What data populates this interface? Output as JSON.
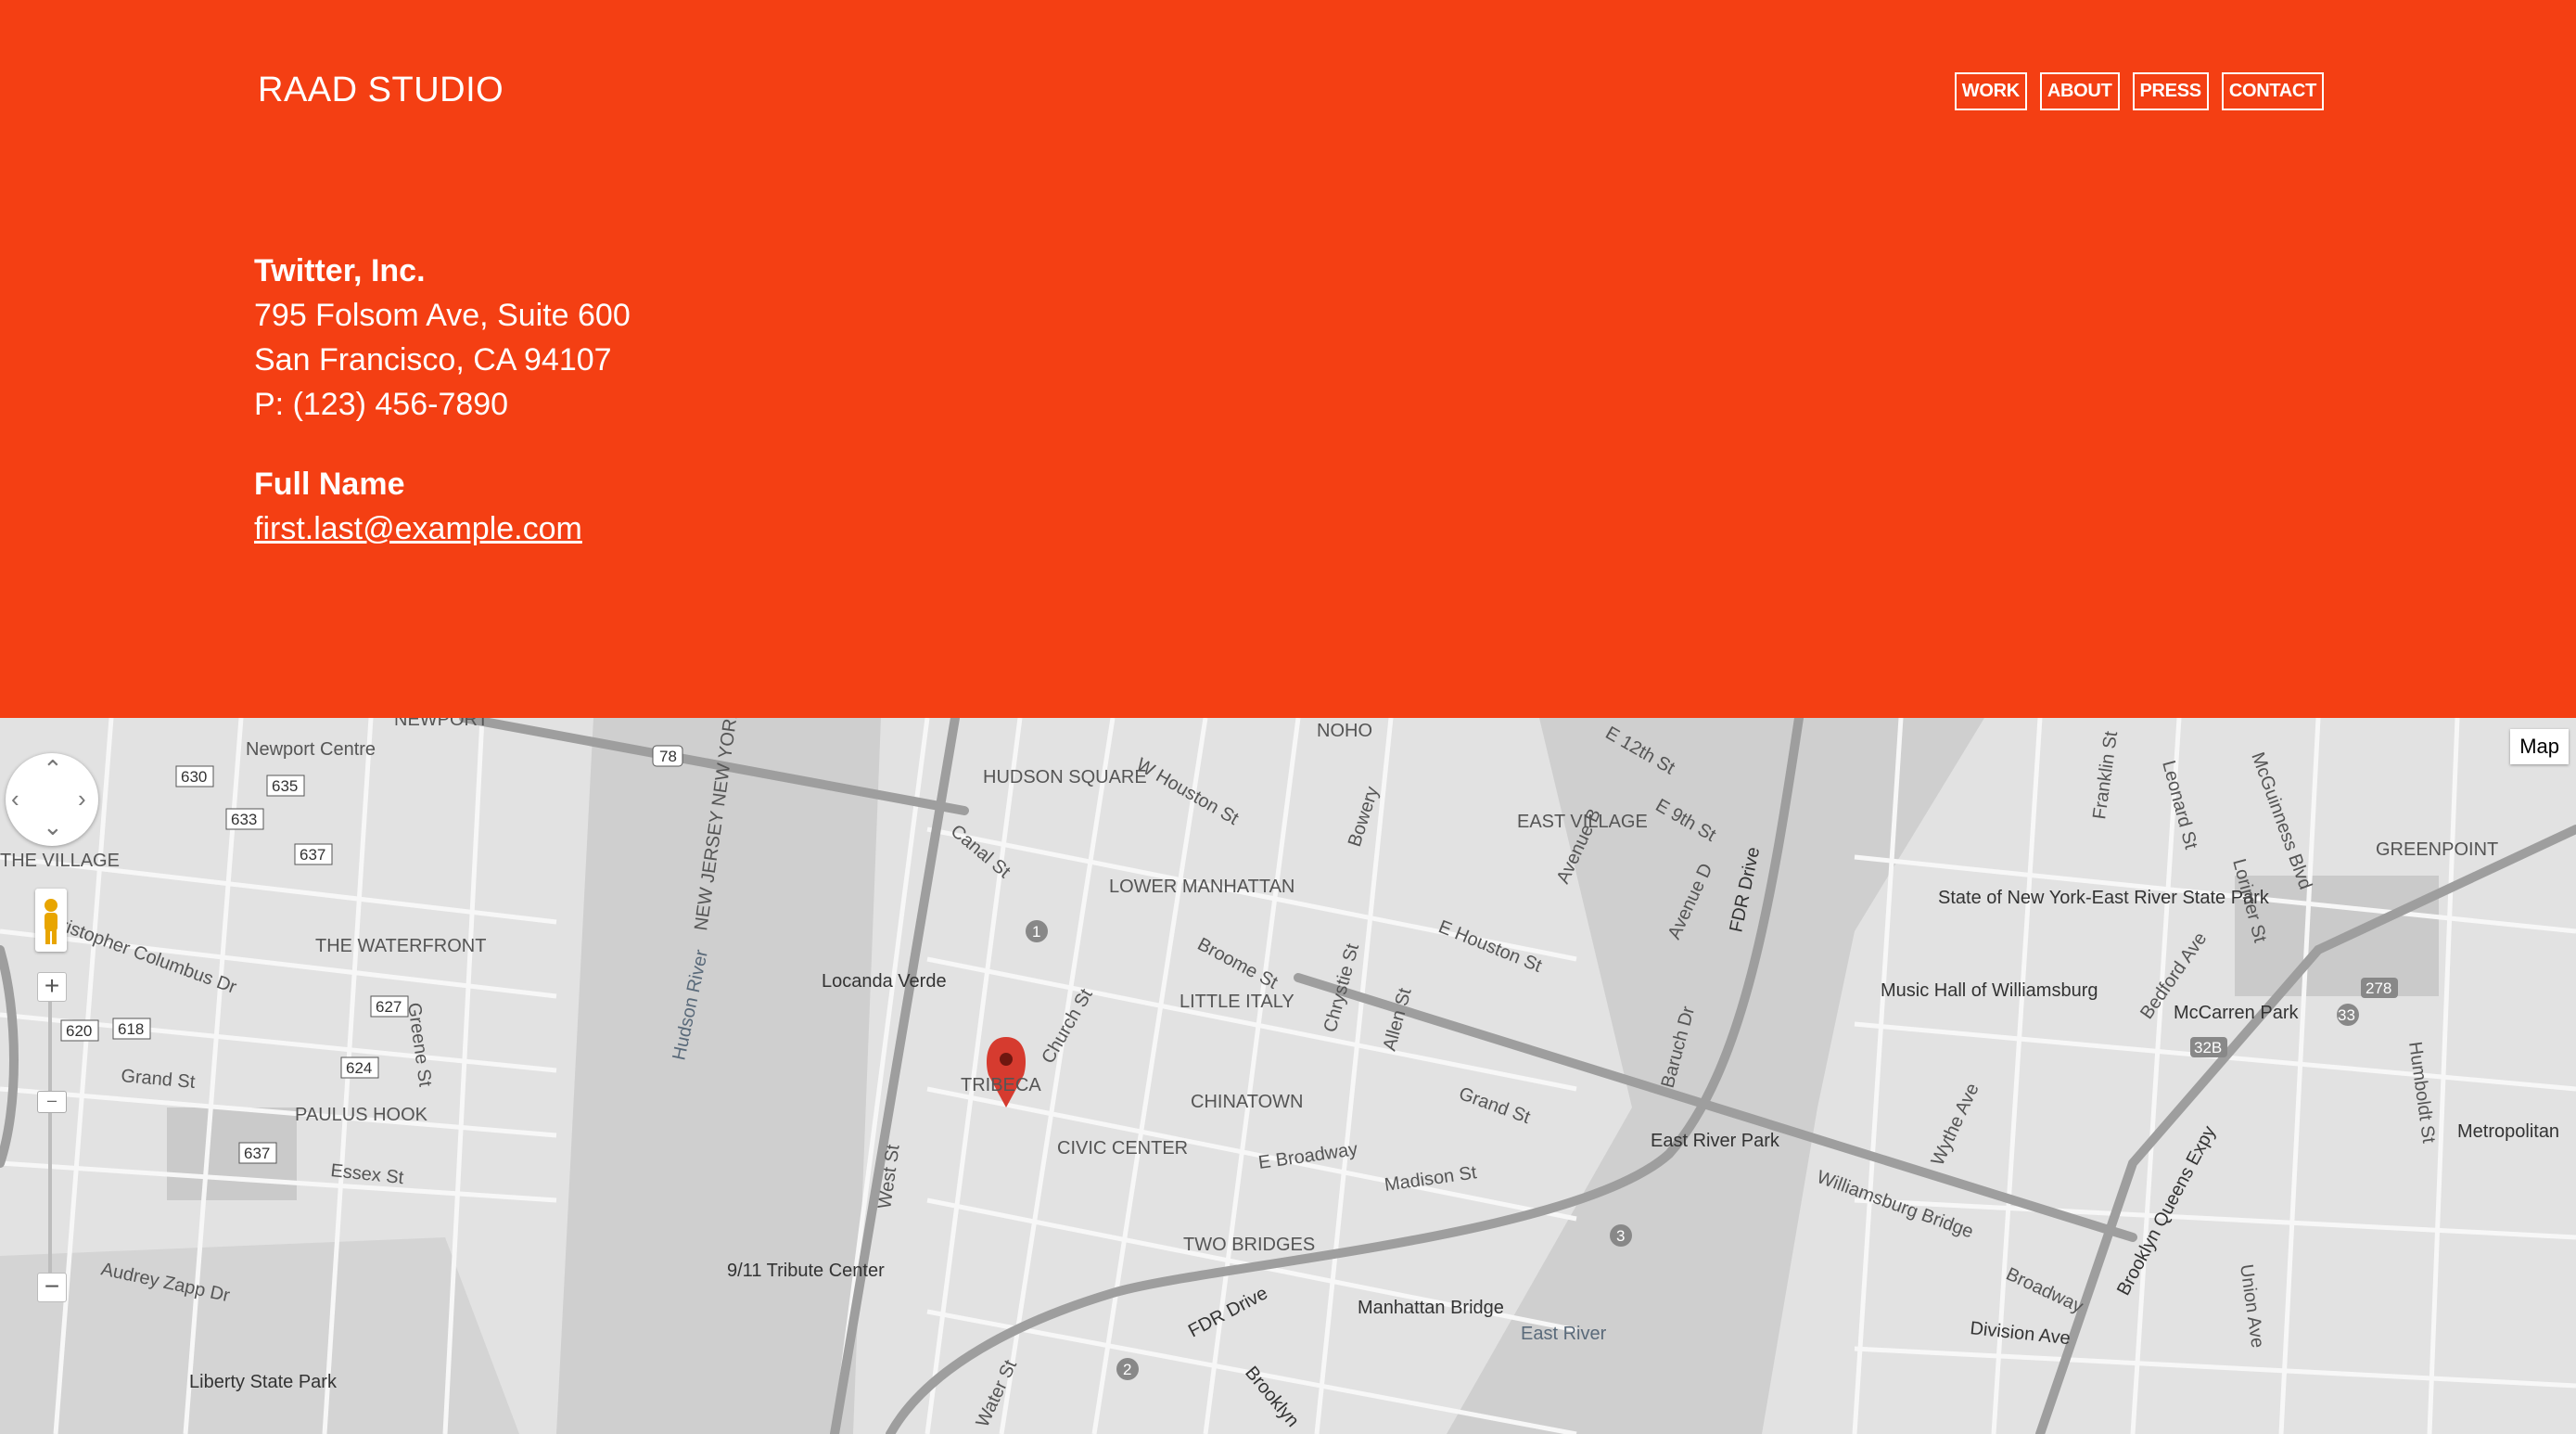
{
  "header": {
    "logo": "RAAD STUDIO",
    "nav": [
      "WORK",
      "ABOUT",
      "PRESS",
      "CONTACT"
    ]
  },
  "contact": {
    "company": "Twitter, Inc.",
    "address1": "795 Folsom Ave, Suite 600",
    "address2": "San Francisco, CA 94107",
    "phone": "P: (123) 456-7890",
    "name": "Full Name",
    "email": "first.last@example.com"
  },
  "map": {
    "type_button": "Map",
    "labels": {
      "newport_centre": "Newport Centre",
      "the_village": "THE VILLAGE",
      "the_waterfront": "THE WATERFRONT",
      "newport": "NEWPORT",
      "paulus_hook": "PAULUS HOOK",
      "hudson_square": "HUDSON SQUARE",
      "noho": "NOHO",
      "east_village": "EAST VILLAGE",
      "lower_manhattan": "LOWER MANHATTAN",
      "little_italy": "LITTLE ITALY",
      "tribeca": "TRIBECA",
      "chinatown": "CHINATOWN",
      "civic_center": "CIVIC CENTER",
      "two_bridges": "TWO BRIDGES",
      "greenpoint": "GREENPOINT",
      "locanda_verde": "Locanda Verde",
      "tribute_center": "9/11 Tribute Center",
      "liberty_state_park": "Liberty State Park",
      "manhattan_bridge": "Manhattan Bridge",
      "east_river": "East River",
      "east_river_park": "East River Park",
      "state_park": "State of New York-East River State Park",
      "music_hall": "Music Hall of Williamsburg",
      "mccarren_park": "McCarren Park",
      "metropolitan": "Metropolitan",
      "hudson_river": "Hudson River",
      "new_jersey_new_york": "NEW JERSEY NEW YORK",
      "christopher_columbus_dr": "Christopher Columbus Dr",
      "grand_st": "Grand St",
      "essex_st": "Essex St",
      "audrey_zapp_dr": "Audrey Zapp Dr",
      "greene_st": "Greene St",
      "west_st": "West St",
      "canal_st": "Canal St",
      "church_st": "Church St",
      "broome_st": "Broome St",
      "w_houston_st": "W Houston St",
      "e_houston_st": "E Houston St",
      "chrystie_st": "Chrystie St",
      "allen_st": "Allen St",
      "bowery": "Bowery",
      "grand_st_east": "Grand St",
      "e_broadway": "E Broadway",
      "madison_st": "Madison St",
      "fdr_drive": "FDR Drive",
      "fdr_drive_2": "FDR Drive",
      "williamsburg_bridge": "Williamsburg Bridge",
      "broadway": "Broadway",
      "division_ave": "Division Ave",
      "bqe": "Brooklyn Queens Expy",
      "franklin_st": "Franklin St",
      "leonard_st": "Leonard St",
      "lorimer_st": "Lorimer St",
      "bedford_ave": "Bedford Ave",
      "humboldt_st": "Humboldt St",
      "mcguinness_blvd": "McGuinness Blvd",
      "union_ave": "Union Ave",
      "water_st": "Water St",
      "brooklyn": "Brooklyn",
      "e_12th_st": "E 12th St",
      "e_9th_st": "E 9th St",
      "avenue_b": "Avenue B",
      "avenue_d": "Avenue D",
      "baruch_dr": "Baruch Dr",
      "wythe_ave": "Wythe Ave"
    },
    "shields": [
      "630",
      "635",
      "633",
      "637",
      "627",
      "620",
      "618",
      "624",
      "637",
      "78",
      "1",
      "2",
      "3",
      "278",
      "32B",
      "33"
    ]
  }
}
